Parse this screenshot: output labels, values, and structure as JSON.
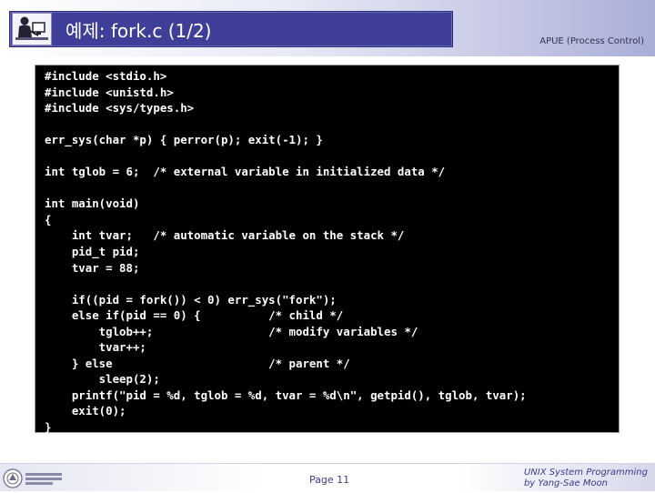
{
  "header": {
    "title": "예제: fork.c (1/2)",
    "subtitle": "APUE (Process Control)"
  },
  "code": {
    "lines": [
      "#include <stdio.h>",
      "#include <unistd.h>",
      "#include <sys/types.h>",
      "",
      "err_sys(char *p) { perror(p); exit(-1); }",
      "",
      "int tglob = 6;  /* external variable in initialized data */",
      "",
      "int main(void)",
      "{",
      "    int tvar;   /* automatic variable on the stack */",
      "    pid_t pid;",
      "    tvar = 88;",
      "",
      "    if((pid = fork()) < 0) err_sys(\"fork\");",
      "    else if(pid == 0) {          /* child */",
      "        tglob++;                 /* modify variables */",
      "        tvar++;",
      "    } else                       /* parent */",
      "        sleep(2);",
      "    printf(\"pid = %d, tglob = %d, tvar = %d\\n\", getpid(), tglob, tvar);",
      "    exit(0);",
      "}"
    ]
  },
  "footer": {
    "page": "Page 11",
    "credit_line1": "UNIX System Programming",
    "credit_line2": "by Yang-Sae Moon"
  },
  "icons": {
    "header_logo": "person-at-computer-icon",
    "footer_logo": "university-seal-icon"
  },
  "colors": {
    "title_box": "#3f3f9a",
    "code_background": "#000000",
    "code_text": "#ffffff",
    "footer_text": "#3a3a8a"
  }
}
